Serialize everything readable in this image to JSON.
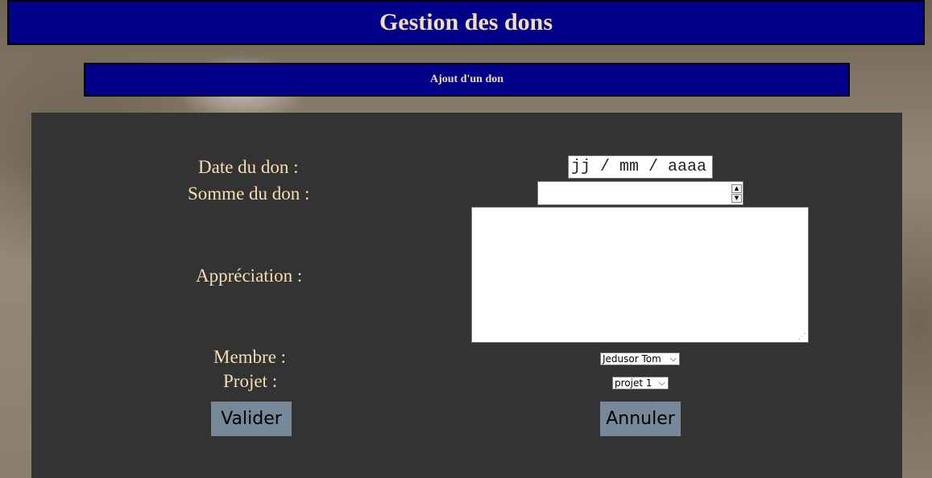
{
  "header": {
    "title": "Gestion des dons"
  },
  "subheader": {
    "title": "Ajout d'un don"
  },
  "form": {
    "date_label": "Date du don :",
    "date_value": "jj / mm / aaaa",
    "amount_label": "Somme du don :",
    "amount_value": "",
    "spin_up": "▲",
    "spin_down": "▼",
    "appreciation_label": "Appréciation :",
    "appreciation_value": "",
    "member_label": "Membre :",
    "member_selected": "Jedusor Tom",
    "project_label": "Projet :",
    "project_selected": "projet 1",
    "chevron": "⌵",
    "validate_label": "Valider",
    "cancel_label": "Annuler"
  },
  "colors": {
    "header_bg": "#000088",
    "label_text": "#f5deb3",
    "panel_bg": "#333333",
    "button_bg": "#778899"
  }
}
